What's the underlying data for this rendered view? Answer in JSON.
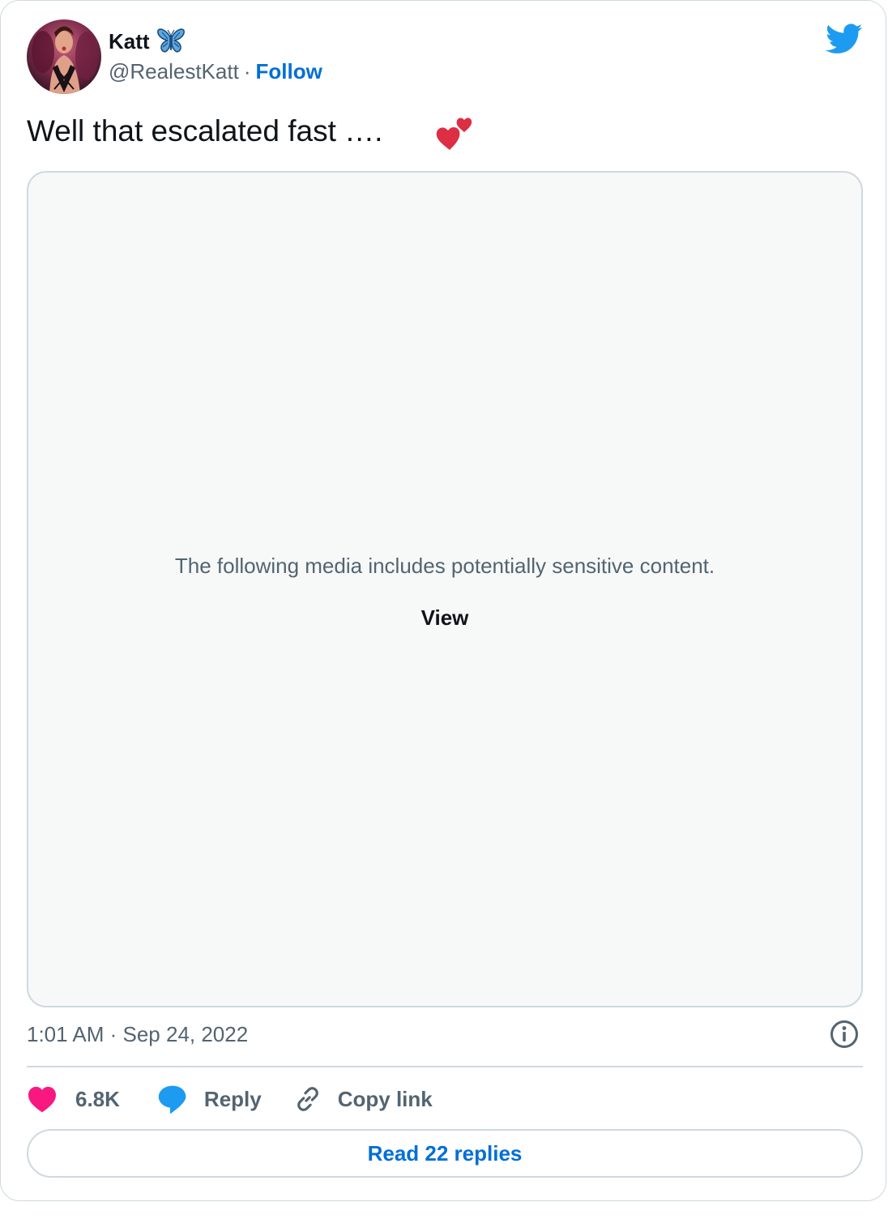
{
  "author": {
    "display_name": "Katt",
    "handle": "@RealestKatt",
    "separator": "·",
    "follow_label": "Follow"
  },
  "tweet": {
    "text": "Well that escalated fast ….",
    "emoji_icon": "two-hearts-icon"
  },
  "media": {
    "warning_text": "The following media includes potentially sensitive content.",
    "view_label": "View"
  },
  "meta": {
    "timestamp": "1:01 AM · Sep 24, 2022"
  },
  "actions": {
    "like_count": "6.8K",
    "reply_label": "Reply",
    "copy_link_label": "Copy link"
  },
  "footer": {
    "read_replies_label": "Read 22 replies"
  },
  "colors": {
    "brand_blue": "#1d9bf0",
    "link_blue": "#006fd6",
    "like_pink": "#f91880",
    "text_primary": "#0f1419",
    "text_secondary": "#536471",
    "border": "#cfd9de",
    "media_bg": "#f7f9f9"
  }
}
